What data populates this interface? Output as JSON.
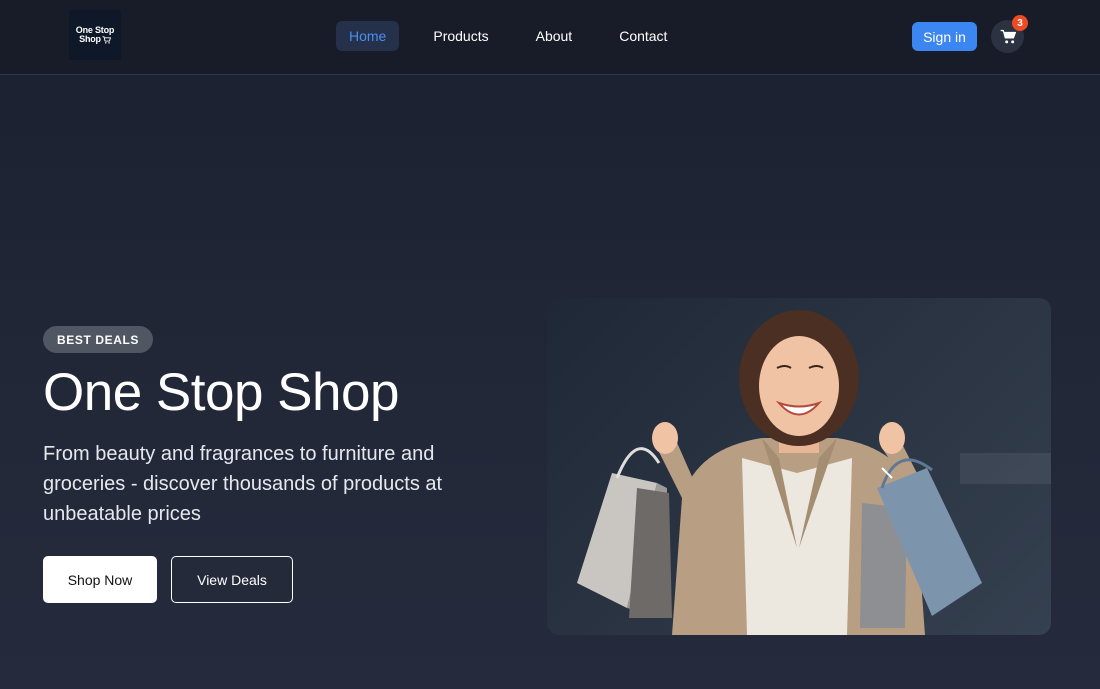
{
  "brand": {
    "line1": "One Stop",
    "line2": "Shop"
  },
  "nav": [
    {
      "label": "Home",
      "active": true
    },
    {
      "label": "Products",
      "active": false
    },
    {
      "label": "About",
      "active": false
    },
    {
      "label": "Contact",
      "active": false
    }
  ],
  "header": {
    "signin_label": "Sign in",
    "cart_count": "3",
    "cart_icon": "shopping-cart-icon"
  },
  "hero": {
    "badge": "BEST DEALS",
    "title": "One Stop Shop",
    "subtitle": "From beauty and fragrances to furniture and groceries - discover thousands of products at unbeatable prices",
    "primary_cta": "Shop Now",
    "secondary_cta": "View Deals",
    "image_subject": "smiling woman holding shopping bags"
  },
  "colors": {
    "accent": "#3b86f0",
    "badge_red": "#f04a23",
    "header_bg": "#181c28",
    "page_bg": "#222838"
  }
}
